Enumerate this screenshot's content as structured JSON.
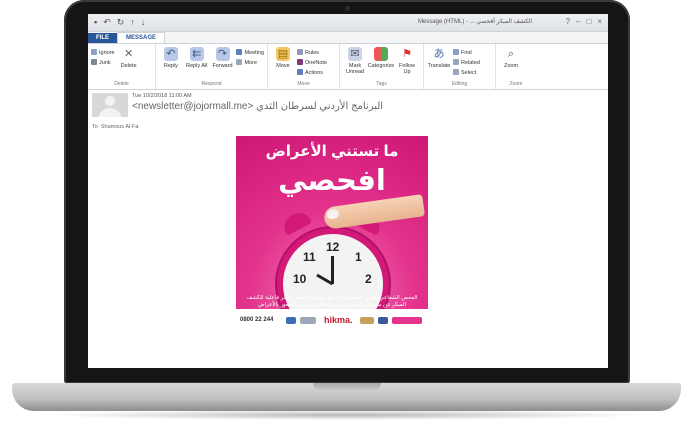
{
  "window": {
    "title": "الكشف المبكر أفحصي ... - Message (HTML)"
  },
  "tabs": [
    {
      "label": "FILE"
    },
    {
      "label": "MESSAGE"
    }
  ],
  "ribbon": {
    "delete_group": {
      "label": "Delete",
      "ignore": "Ignore",
      "junk": "Junk",
      "delete": "Delete"
    },
    "respond_group": {
      "label": "Respond",
      "reply": "Reply",
      "reply_all": "Reply All",
      "forward": "Forward",
      "meeting": "Meeting",
      "more": "More"
    },
    "move_group": {
      "label": "Move",
      "move": "Move",
      "rules": "Rules",
      "onenote": "OneNote",
      "actions": "Actions"
    },
    "tags_group": {
      "label": "Tags",
      "mark_unread": "Mark Unread",
      "categorize": "Categorize",
      "follow_up": "Follow Up"
    },
    "editing_group": {
      "label": "Editing",
      "translate": "Translate",
      "find": "Find",
      "related": "Related",
      "select": "Select"
    },
    "zoom_group": {
      "label": "Zoom",
      "zoom": "Zoom"
    }
  },
  "message": {
    "date": "Tue 10/2/2018 11:00 AM",
    "sender_name": "البرنامج الأردني لسرطان الثدي",
    "sender_email": "<newsletter@jojormall.me>",
    "to_label": "To",
    "to_value": "Shamous Al-Fa"
  },
  "poster": {
    "headline_small": "ما تستني الأعراض",
    "headline_big": "افحصي",
    "clock_numbers": [
      "10",
      "11",
      "12",
      "1",
      "2"
    ],
    "caption": "الفحص الشعاعي للثدي \"الماموغرام\" هو طريقة الفحص الأكثر فاعلية للكشف المبكر عن سرطان الثدي في مرحلة الأولى وقبل الشعور بالأعراض",
    "phone": "0800 22 244",
    "sponsor": "hikma.",
    "colors": {
      "pink": "#e3338c",
      "dark_pink": "#cf1676",
      "clock_face": "#f3f3f3"
    }
  }
}
